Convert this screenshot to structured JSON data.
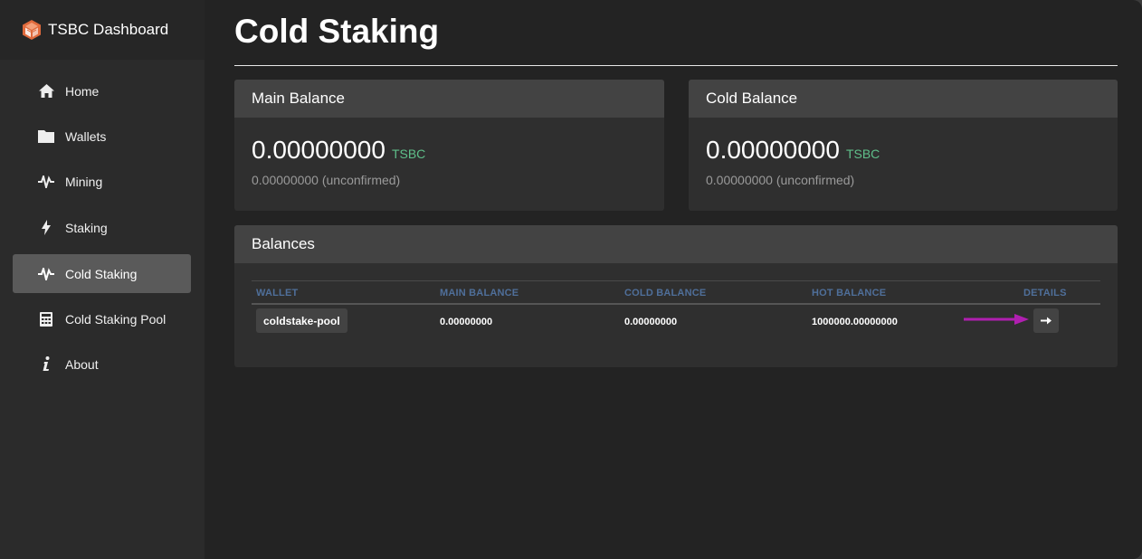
{
  "app": {
    "title": "TSBC Dashboard"
  },
  "sidebar": {
    "items": [
      {
        "label": "Home",
        "icon": "home-icon"
      },
      {
        "label": "Wallets",
        "icon": "folder-icon"
      },
      {
        "label": "Mining",
        "icon": "pulse-icon"
      },
      {
        "label": "Staking",
        "icon": "bolt-icon"
      },
      {
        "label": "Cold Staking",
        "icon": "pulse-icon",
        "active": true
      },
      {
        "label": "Cold Staking Pool",
        "icon": "calculator-icon"
      },
      {
        "label": "About",
        "icon": "info-icon"
      }
    ]
  },
  "page": {
    "title": "Cold Staking"
  },
  "main_balance": {
    "heading": "Main Balance",
    "amount": "0.00000000",
    "unit": "TSBC",
    "unconfirmed": "0.00000000 (unconfirmed)"
  },
  "cold_balance": {
    "heading": "Cold Balance",
    "amount": "0.00000000",
    "unit": "TSBC",
    "unconfirmed": "0.00000000 (unconfirmed)"
  },
  "balances": {
    "heading": "Balances",
    "columns": [
      "WALLET",
      "MAIN BALANCE",
      "COLD BALANCE",
      "HOT BALANCE",
      "DETAILS"
    ],
    "rows": [
      {
        "wallet": "coldstake-pool",
        "main": "0.00000000",
        "cold": "0.00000000",
        "hot": "1000000.00000000"
      }
    ]
  },
  "colors": {
    "accent_unit": "#5fbf8a",
    "table_header": "#4f6f9a",
    "annotation_arrow": "#b01fb0"
  }
}
